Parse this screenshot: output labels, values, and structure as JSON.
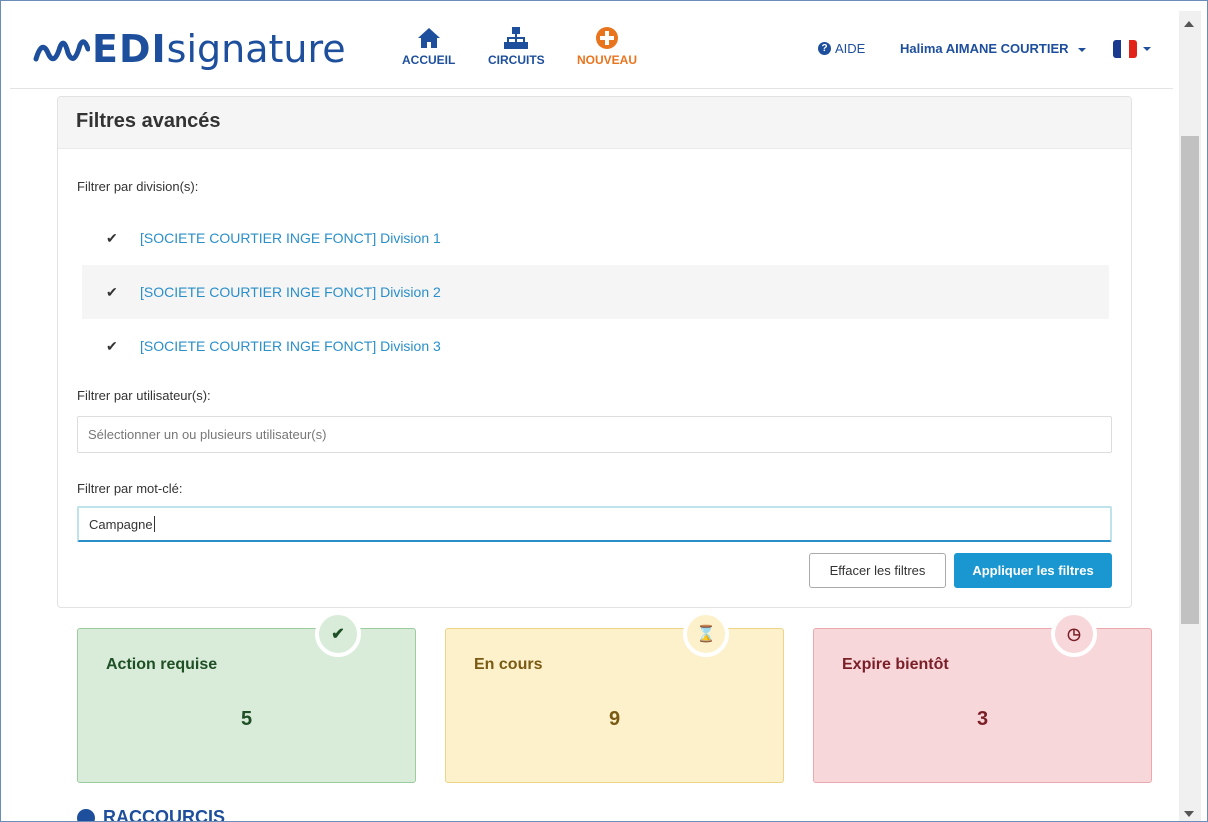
{
  "header": {
    "brand_edi": "EDI",
    "brand_signature": "signature",
    "nav": [
      {
        "label": "ACCUEIL",
        "icon": "home-icon"
      },
      {
        "label": "CIRCUITS",
        "icon": "sitemap-icon"
      },
      {
        "label": "NOUVEAU",
        "icon": "plus-circle-icon"
      }
    ],
    "help_label": "AIDE",
    "user_name": "Halima AIMANE COURTIER",
    "language_flag": "french-flag-icon"
  },
  "filters": {
    "title": "Filtres avancés",
    "division_label": "Filtrer par division(s):",
    "divisions": [
      {
        "label": "[SOCIETE COURTIER INGE FONCT] Division 1",
        "checked": true
      },
      {
        "label": "[SOCIETE COURTIER INGE FONCT] Division 2",
        "checked": true
      },
      {
        "label": "[SOCIETE COURTIER INGE FONCT] Division 3",
        "checked": true
      }
    ],
    "user_label": "Filtrer par utilisateur(s):",
    "user_placeholder": "Sélectionner un ou plusieurs utilisateur(s)",
    "keyword_label": "Filtrer par mot-clé:",
    "keyword_value": "Campagne",
    "clear_button": "Effacer les filtres",
    "apply_button": "Appliquer les filtres"
  },
  "cards": [
    {
      "title": "Action requise",
      "count": "5",
      "icon": "check-icon",
      "color": "#d8ecd9"
    },
    {
      "title": "En cours",
      "count": "9",
      "icon": "hourglass-icon",
      "color": "#fdf1cc"
    },
    {
      "title": "Expire bientôt",
      "count": "3",
      "icon": "clock-icon",
      "color": "#f8d7da"
    }
  ],
  "shortcuts": {
    "title": "RACCOURCIS"
  },
  "colors": {
    "brand": "#1e4f9c",
    "accent": "#1a97d0",
    "nouveau": "#e8741e"
  }
}
